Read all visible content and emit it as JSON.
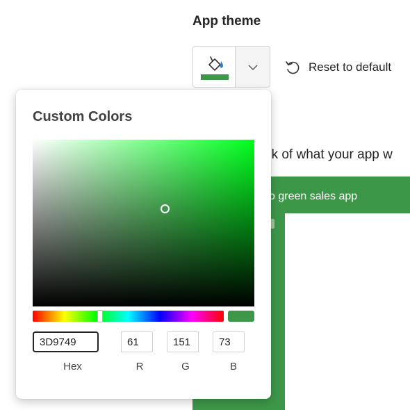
{
  "header": {
    "title": "App theme",
    "reset_label": "Reset to default",
    "theme_color": "#3d9749",
    "icons": [
      "paint-bucket-icon",
      "chevron-down-icon",
      "reset-icon"
    ]
  },
  "preview": {
    "text": "ek of what your app w",
    "app_title": "o green sales app",
    "app_color": "#3d9749"
  },
  "custom_colors": {
    "title": "Custom Colors",
    "hue_color": "#00ff1e",
    "fields": {
      "hex": {
        "label": "Hex",
        "value": "3D9749"
      },
      "r": {
        "label": "R",
        "value": "61"
      },
      "g": {
        "label": "G",
        "value": "151"
      },
      "b": {
        "label": "B",
        "value": "73"
      }
    }
  }
}
